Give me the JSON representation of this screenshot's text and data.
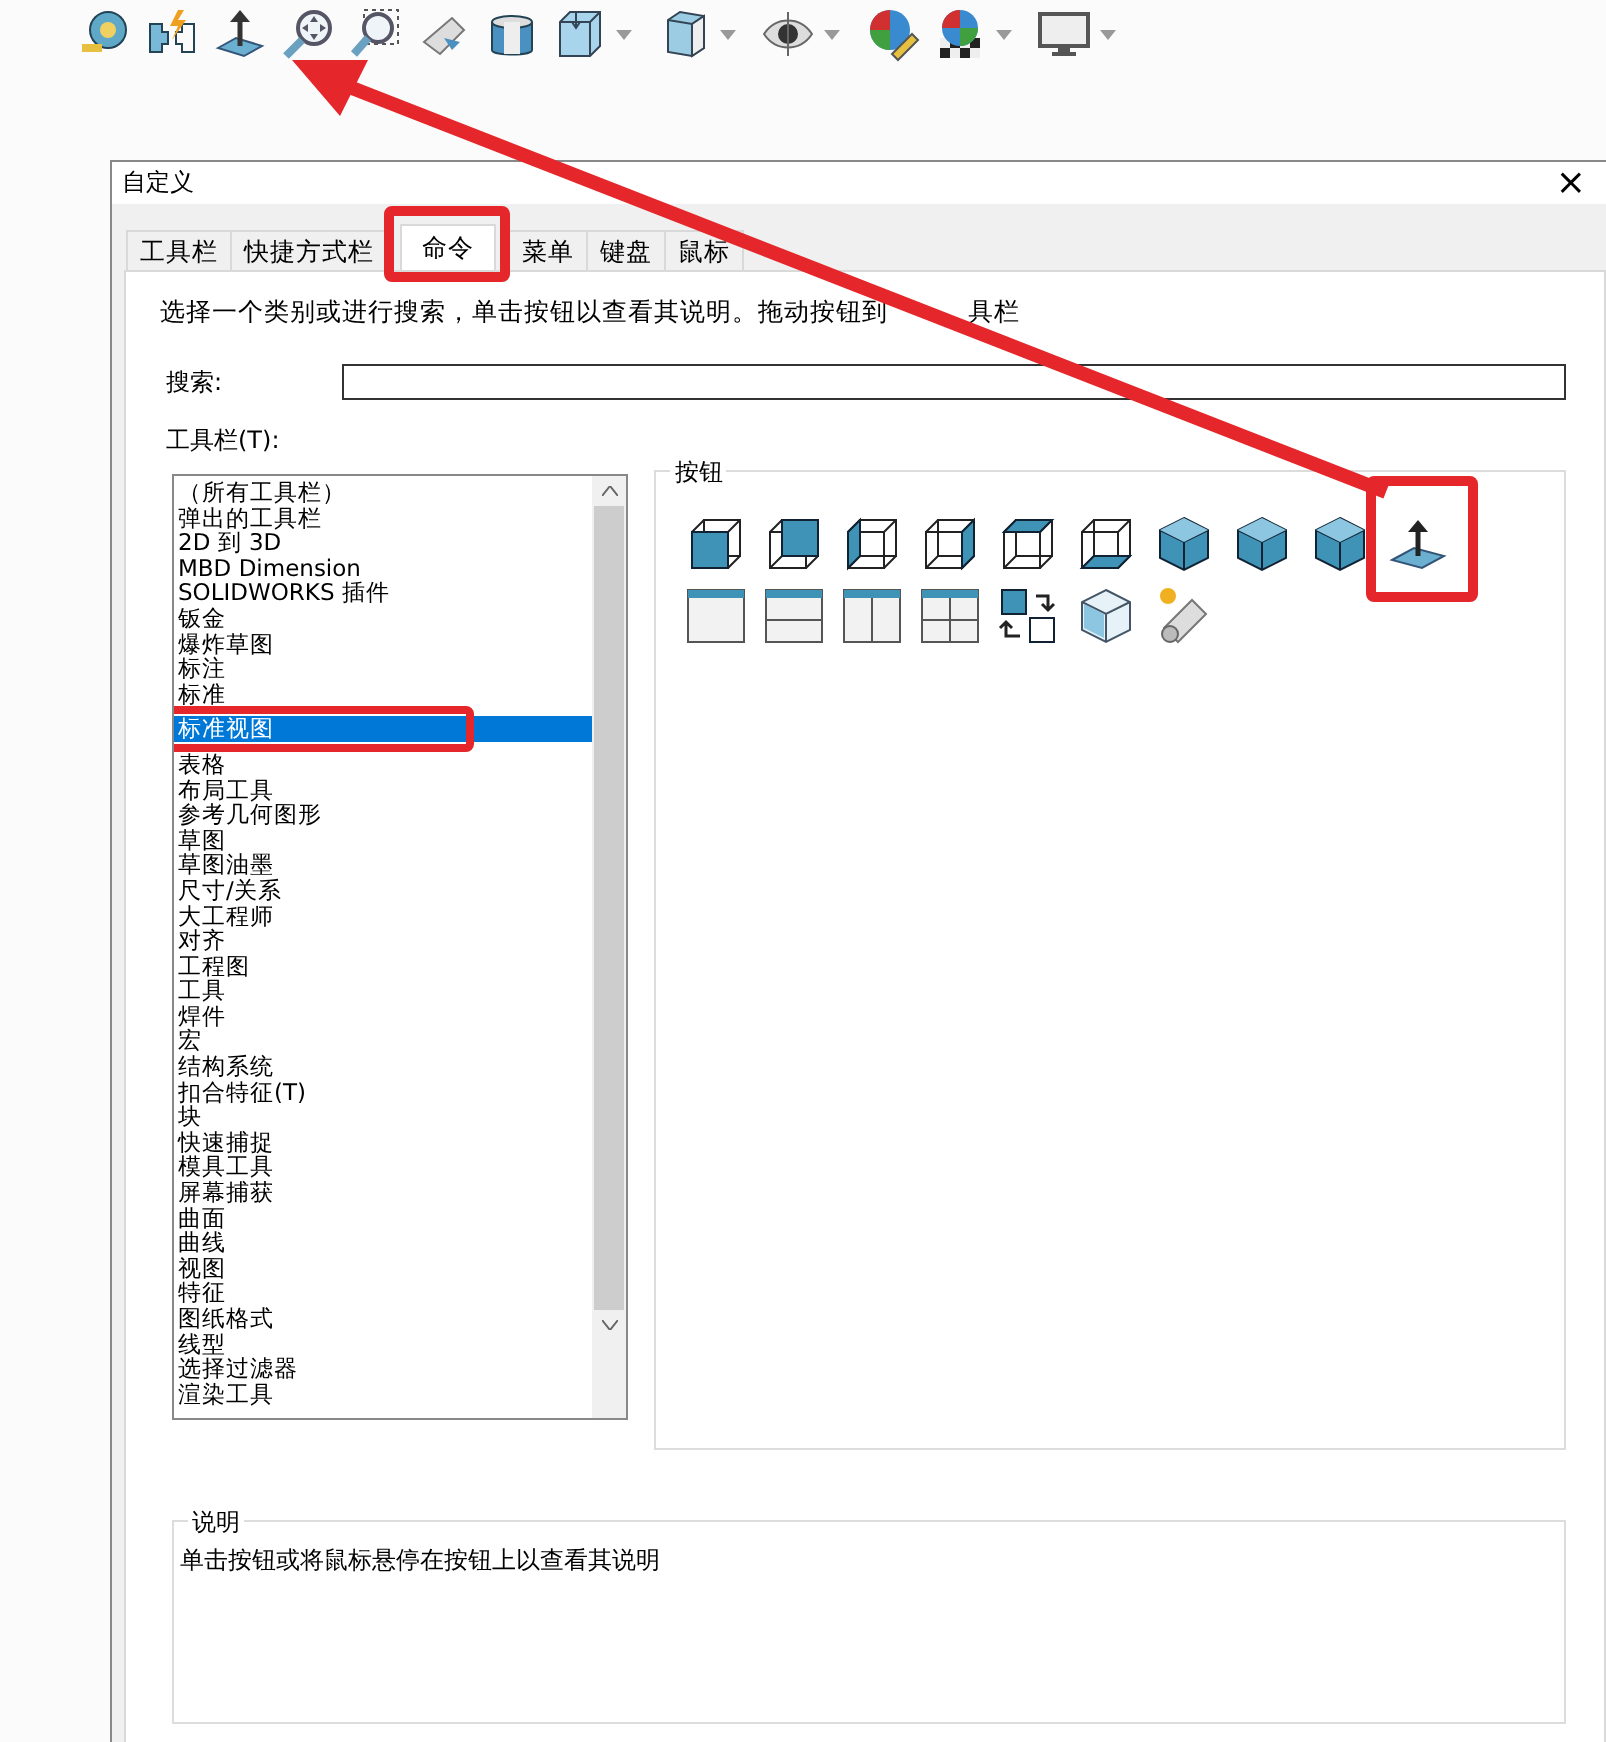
{
  "toolbar": [
    {
      "dropdown": false
    },
    {
      "dropdown": false
    },
    {
      "dropdown": false
    },
    {
      "dropdown": false
    },
    {
      "dropdown": false
    },
    {
      "dropdown": false
    },
    {
      "dropdown": false
    },
    {
      "dropdown": true
    },
    {
      "dropdown": true
    },
    {
      "dropdown": true
    },
    {
      "dropdown": false
    },
    {
      "dropdown": true
    },
    {
      "dropdown": true
    }
  ],
  "dialog": {
    "title": "自定义",
    "close": "×",
    "tabs": [
      {
        "label": "工具栏",
        "selected": false,
        "highlighted": false
      },
      {
        "label": "快捷方式栏",
        "selected": false,
        "highlighted": false
      },
      {
        "label": "命令",
        "selected": true,
        "highlighted": true
      },
      {
        "label": "菜单",
        "selected": false,
        "highlighted": false
      },
      {
        "label": "键盘",
        "selected": false,
        "highlighted": false
      },
      {
        "label": "鼠标",
        "selected": false,
        "highlighted": false
      }
    ],
    "instruction": "选择一个类别或进行搜索，单击按钮以查看其说明。拖动按钮到",
    "instruction_tail": "具栏",
    "search": {
      "label": "搜索:"
    },
    "category_list": {
      "label": "工具栏(T):",
      "items": [
        {
          "label": "（所有工具栏）",
          "selected": false,
          "highlighted": false
        },
        {
          "label": "弹出的工具栏",
          "selected": false,
          "highlighted": false
        },
        {
          "label": "2D 到 3D",
          "selected": false,
          "highlighted": false
        },
        {
          "label": "MBD Dimension",
          "selected": false,
          "highlighted": false
        },
        {
          "label": "SOLIDWORKS 插件",
          "selected": false,
          "highlighted": false
        },
        {
          "label": "钣金",
          "selected": false,
          "highlighted": false
        },
        {
          "label": "爆炸草图",
          "selected": false,
          "highlighted": false
        },
        {
          "label": "标注",
          "selected": false,
          "highlighted": false
        },
        {
          "label": "标准",
          "selected": false,
          "highlighted": false
        },
        {
          "label": "标准视图",
          "selected": true,
          "highlighted": true
        },
        {
          "label": "表格",
          "selected": false,
          "highlighted": false
        },
        {
          "label": "布局工具",
          "selected": false,
          "highlighted": false
        },
        {
          "label": "参考几何图形",
          "selected": false,
          "highlighted": false
        },
        {
          "label": "草图",
          "selected": false,
          "highlighted": false
        },
        {
          "label": "草图油墨",
          "selected": false,
          "highlighted": false
        },
        {
          "label": "尺寸/关系",
          "selected": false,
          "highlighted": false
        },
        {
          "label": "大工程师",
          "selected": false,
          "highlighted": false
        },
        {
          "label": "对齐",
          "selected": false,
          "highlighted": false
        },
        {
          "label": "工程图",
          "selected": false,
          "highlighted": false
        },
        {
          "label": "工具",
          "selected": false,
          "highlighted": false
        },
        {
          "label": "焊件",
          "selected": false,
          "highlighted": false
        },
        {
          "label": "宏",
          "selected": false,
          "highlighted": false
        },
        {
          "label": "结构系统",
          "selected": false,
          "highlighted": false
        },
        {
          "label": "扣合特征(T)",
          "selected": false,
          "highlighted": false
        },
        {
          "label": "块",
          "selected": false,
          "highlighted": false
        },
        {
          "label": "快速捕捉",
          "selected": false,
          "highlighted": false
        },
        {
          "label": "模具工具",
          "selected": false,
          "highlighted": false
        },
        {
          "label": "屏幕捕获",
          "selected": false,
          "highlighted": false
        },
        {
          "label": "曲面",
          "selected": false,
          "highlighted": false
        },
        {
          "label": "曲线",
          "selected": false,
          "highlighted": false
        },
        {
          "label": "视图",
          "selected": false,
          "highlighted": false
        },
        {
          "label": "特征",
          "selected": false,
          "highlighted": false
        },
        {
          "label": "图纸格式",
          "selected": false,
          "highlighted": false
        },
        {
          "label": "线型",
          "selected": false,
          "highlighted": false
        },
        {
          "label": "选择过滤器",
          "selected": false,
          "highlighted": false
        },
        {
          "label": "渲染工具",
          "selected": false,
          "highlighted": false
        }
      ]
    },
    "button_panel": {
      "title": "按钮",
      "buttons": [
        {
          "highlighted": false
        },
        {
          "highlighted": false
        },
        {
          "highlighted": false
        },
        {
          "highlighted": false
        },
        {
          "highlighted": false
        },
        {
          "highlighted": false
        },
        {
          "highlighted": false
        },
        {
          "highlighted": false
        },
        {
          "highlighted": false
        },
        {
          "highlighted": true
        },
        {
          "highlighted": false
        },
        {
          "highlighted": false
        },
        {
          "highlighted": false
        },
        {
          "highlighted": false
        },
        {
          "highlighted": false
        },
        {
          "highlighted": false
        },
        {
          "highlighted": false
        }
      ]
    },
    "description": {
      "title": "说明",
      "text": "单击按钮或将鼠标悬停在按钮上以查看其说明"
    }
  },
  "annotations": [
    {
      "kind": "arrow"
    }
  ]
}
